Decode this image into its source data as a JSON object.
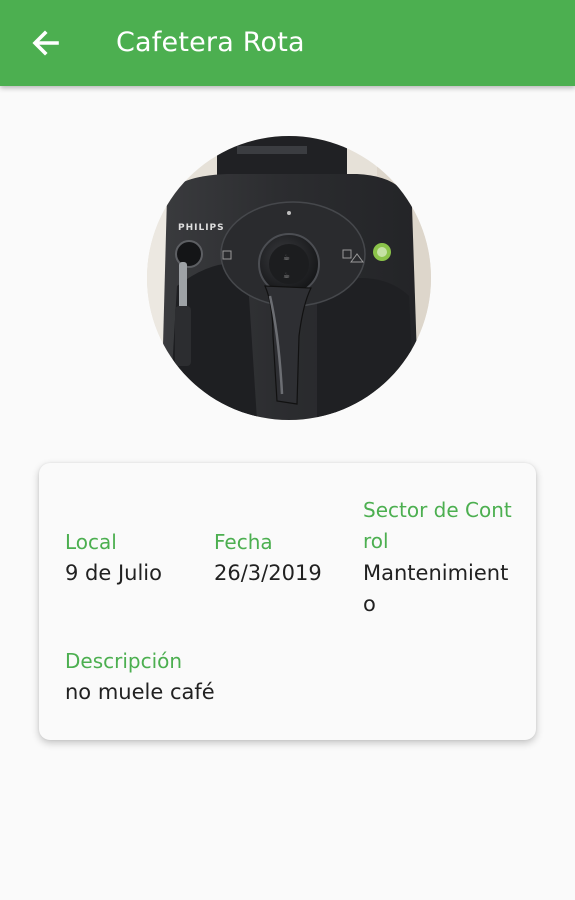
{
  "appbar": {
    "title": "Cafetera Rota",
    "back_icon": "arrow-back-icon",
    "color": "#4caf50"
  },
  "photo": {
    "alt": "Cafetera PHILIPS",
    "brand_text": "PHILIPS"
  },
  "details": {
    "local_label": "Local",
    "local_value": "9 de Julio",
    "fecha_label": "Fecha",
    "fecha_value": "26/3/2019",
    "sector_label": "Sector de Control",
    "sector_value": "Mantenimiento",
    "descripcion_label": "Descripción",
    "descripcion_value": "no muele café"
  },
  "colors": {
    "accent": "#4caf50",
    "text": "#212121",
    "background": "#fafafa"
  }
}
